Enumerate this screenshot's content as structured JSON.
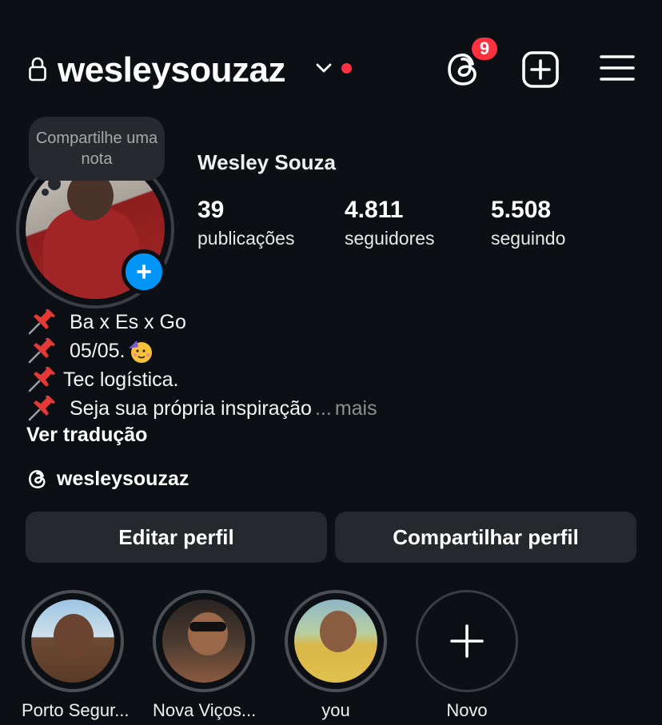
{
  "header": {
    "username": "wesleysouzaz",
    "threads_badge": "9",
    "icons": [
      "lock-icon",
      "chevron-down-icon",
      "threads-icon",
      "add-square-icon",
      "menu-icon"
    ],
    "accent_red": "#ff3040"
  },
  "profile": {
    "note_text": "Compartilhe uma nota",
    "full_name": "Wesley Souza",
    "stats": [
      {
        "value": "39",
        "label": "publicações"
      },
      {
        "value": "4.811",
        "label": "seguidores"
      },
      {
        "value": "5.508",
        "label": "seguindo"
      }
    ],
    "bio": [
      {
        "icon": "pin-icon",
        "text": "Ba x Es x Go"
      },
      {
        "icon": "pin-icon",
        "text": "05/05."
      },
      {
        "icon": "pin-icon",
        "text": "Tec logística."
      },
      {
        "icon": "pin-icon",
        "text": "Seja sua própria inspiração"
      }
    ],
    "bio_ellipsis": "...",
    "bio_more": "mais",
    "translate": "Ver tradução",
    "threads_handle": "wesleysouzaz",
    "accent_blue": "#0095f6"
  },
  "actions": {
    "edit": "Editar perfil",
    "share": "Compartilhar perfil"
  },
  "highlights": [
    {
      "label": "Porto Segur..."
    },
    {
      "label": "Nova Viços..."
    },
    {
      "label": "you"
    },
    {
      "label": "Novo"
    }
  ]
}
